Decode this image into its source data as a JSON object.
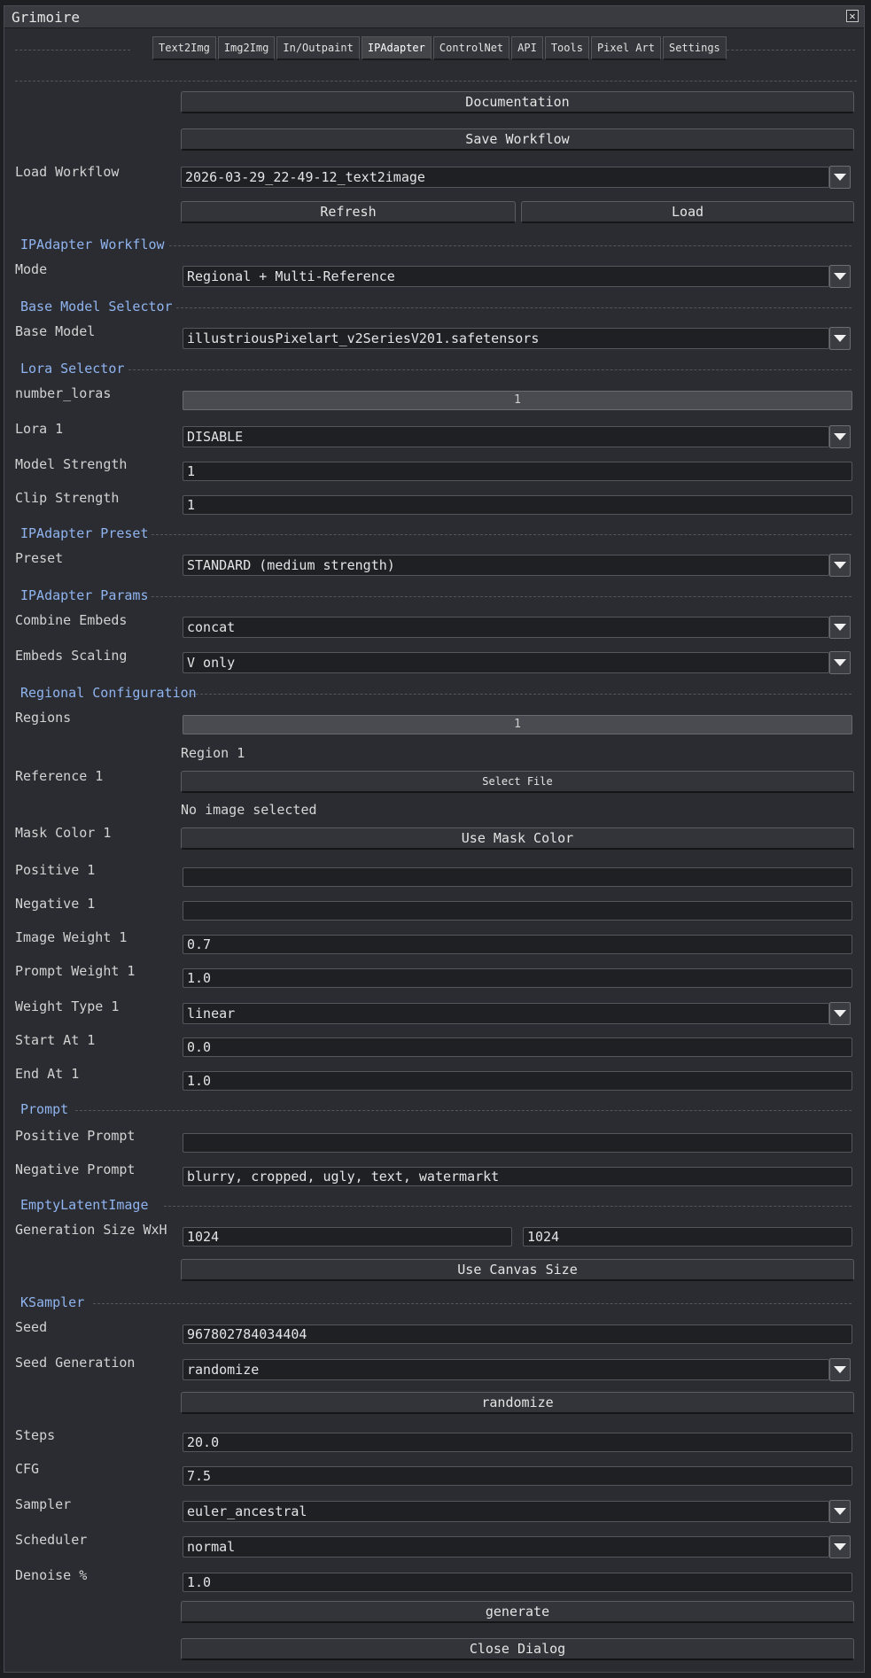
{
  "window": {
    "title": "Grimoire"
  },
  "tabs": [
    "Text2Img",
    "Img2Img",
    "In/Outpaint",
    "IPAdapter",
    "ControlNet",
    "API",
    "Tools",
    "Pixel Art",
    "Settings"
  ],
  "active_tab": "IPAdapter",
  "buttons": {
    "documentation": "Documentation",
    "save_workflow": "Save Workflow",
    "refresh": "Refresh",
    "load": "Load",
    "select_file": "Select File",
    "use_mask_color": "Use Mask Color",
    "use_canvas_size": "Use Canvas Size",
    "randomize": "randomize",
    "generate": "generate",
    "close_dialog": "Close Dialog"
  },
  "load_workflow": {
    "label": "Load Workflow",
    "value": "2026-03-29_22-49-12_text2image"
  },
  "sections": {
    "ipadapter_workflow": "IPAdapter Workflow",
    "base_model_selector": "Base Model Selector",
    "lora_selector": "Lora Selector",
    "ipadapter_preset": "IPAdapter Preset",
    "ipadapter_params": "IPAdapter Params",
    "regional_configuration": "Regional Configuration",
    "prompt": "Prompt",
    "empty_latent_image": "EmptyLatentImage",
    "ksampler": "KSampler"
  },
  "fields": {
    "mode": {
      "label": "Mode",
      "value": "Regional + Multi-Reference"
    },
    "base_model": {
      "label": "Base Model",
      "value": "illustriousPixelart_v2SeriesV201.safetensors"
    },
    "number_loras": {
      "label": "number_loras",
      "value": "1"
    },
    "lora_1": {
      "label": "Lora 1",
      "value": "DISABLE"
    },
    "model_strength": {
      "label": "Model Strength",
      "value": "1"
    },
    "clip_strength": {
      "label": "Clip Strength",
      "value": "1"
    },
    "preset": {
      "label": "Preset",
      "value": "STANDARD (medium strength)"
    },
    "combine_embeds": {
      "label": "Combine Embeds",
      "value": "concat"
    },
    "embeds_scaling": {
      "label": "Embeds Scaling",
      "value": "V only"
    },
    "regions": {
      "label": "Regions",
      "value": "1"
    },
    "region_1_heading": "Region 1",
    "reference_1": {
      "label": "Reference 1",
      "status": "No image selected"
    },
    "mask_color_1": {
      "label": "Mask Color 1"
    },
    "positive_1": {
      "label": "Positive 1",
      "value": ""
    },
    "negative_1": {
      "label": "Negative 1",
      "value": ""
    },
    "image_weight_1": {
      "label": "Image Weight 1",
      "value": "0.7"
    },
    "prompt_weight_1": {
      "label": "Prompt Weight 1",
      "value": "1.0"
    },
    "weight_type_1": {
      "label": "Weight Type 1",
      "value": "linear"
    },
    "start_at_1": {
      "label": "Start At 1",
      "value": "0.0"
    },
    "end_at_1": {
      "label": "End At 1",
      "value": "1.0"
    },
    "positive_prompt": {
      "label": "Positive Prompt",
      "value": ""
    },
    "negative_prompt": {
      "label": "Negative Prompt",
      "value": "blurry, cropped, ugly, text, watermarkt"
    },
    "generation_size": {
      "label": "Generation Size WxH",
      "width": "1024",
      "height": "1024"
    },
    "seed": {
      "label": "Seed",
      "value": "967802784034404"
    },
    "seed_generation": {
      "label": "Seed Generation",
      "value": "randomize"
    },
    "steps": {
      "label": "Steps",
      "value": "20.0"
    },
    "cfg": {
      "label": "CFG",
      "value": "7.5"
    },
    "sampler": {
      "label": "Sampler",
      "value": "euler_ancestral"
    },
    "scheduler": {
      "label": "Scheduler",
      "value": "normal"
    },
    "denoise": {
      "label": "Denoise %",
      "value": "1.0"
    }
  }
}
